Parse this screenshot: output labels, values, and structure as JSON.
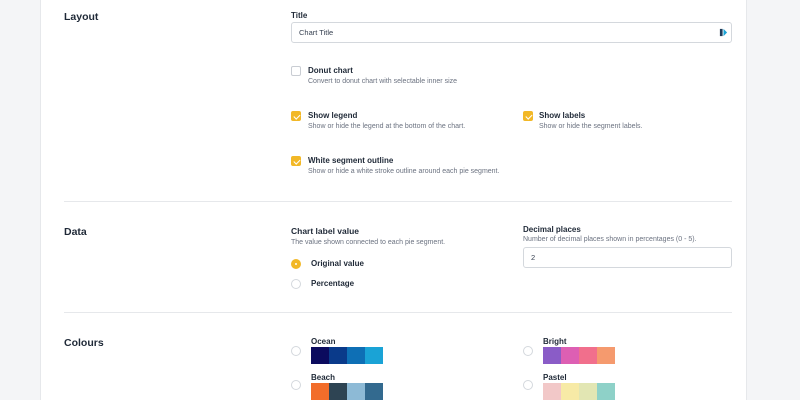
{
  "layout": {
    "section_title": "Layout",
    "title_label": "Title",
    "title_value": "Chart Title",
    "donut": {
      "label": "Donut chart",
      "desc": "Convert to donut chart with selectable inner size",
      "checked": false
    },
    "show_legend": {
      "label": "Show legend",
      "desc": "Show or hide the legend at the bottom of the chart.",
      "checked": true
    },
    "show_labels": {
      "label": "Show labels",
      "desc": "Show or hide the segment labels.",
      "checked": true
    },
    "white_outline": {
      "label": "White segment outline",
      "desc": "Show or hide a white stroke outline around each pie segment.",
      "checked": true
    }
  },
  "data_section": {
    "section_title": "Data",
    "chart_label_value": {
      "label": "Chart label value",
      "desc": "The value shown connected to each pie segment.",
      "options": [
        "Original value",
        "Percentage"
      ],
      "selected": "Original value"
    },
    "decimal_places": {
      "label": "Decimal places",
      "desc": "Number of decimal places shown in percentages (0 - 5).",
      "value": "2"
    }
  },
  "colours": {
    "section_title": "Colours",
    "accent": "#f2b827",
    "palettes": [
      {
        "name": "Ocean",
        "colors": [
          "#0b0b5e",
          "#0a3a8a",
          "#0e6fb5",
          "#1aa3d6"
        ]
      },
      {
        "name": "Bright",
        "colors": [
          "#8a5cc7",
          "#dd5fb3",
          "#f16f8c",
          "#f59a6e"
        ]
      },
      {
        "name": "Beach",
        "colors": [
          "#f26d2a",
          "#2e4453",
          "#8dbad6",
          "#336a8f"
        ]
      },
      {
        "name": "Pastel",
        "colors": [
          "#f2c8c8",
          "#f7eaa6",
          "#e2e6b3",
          "#8ed1c8"
        ]
      }
    ]
  }
}
